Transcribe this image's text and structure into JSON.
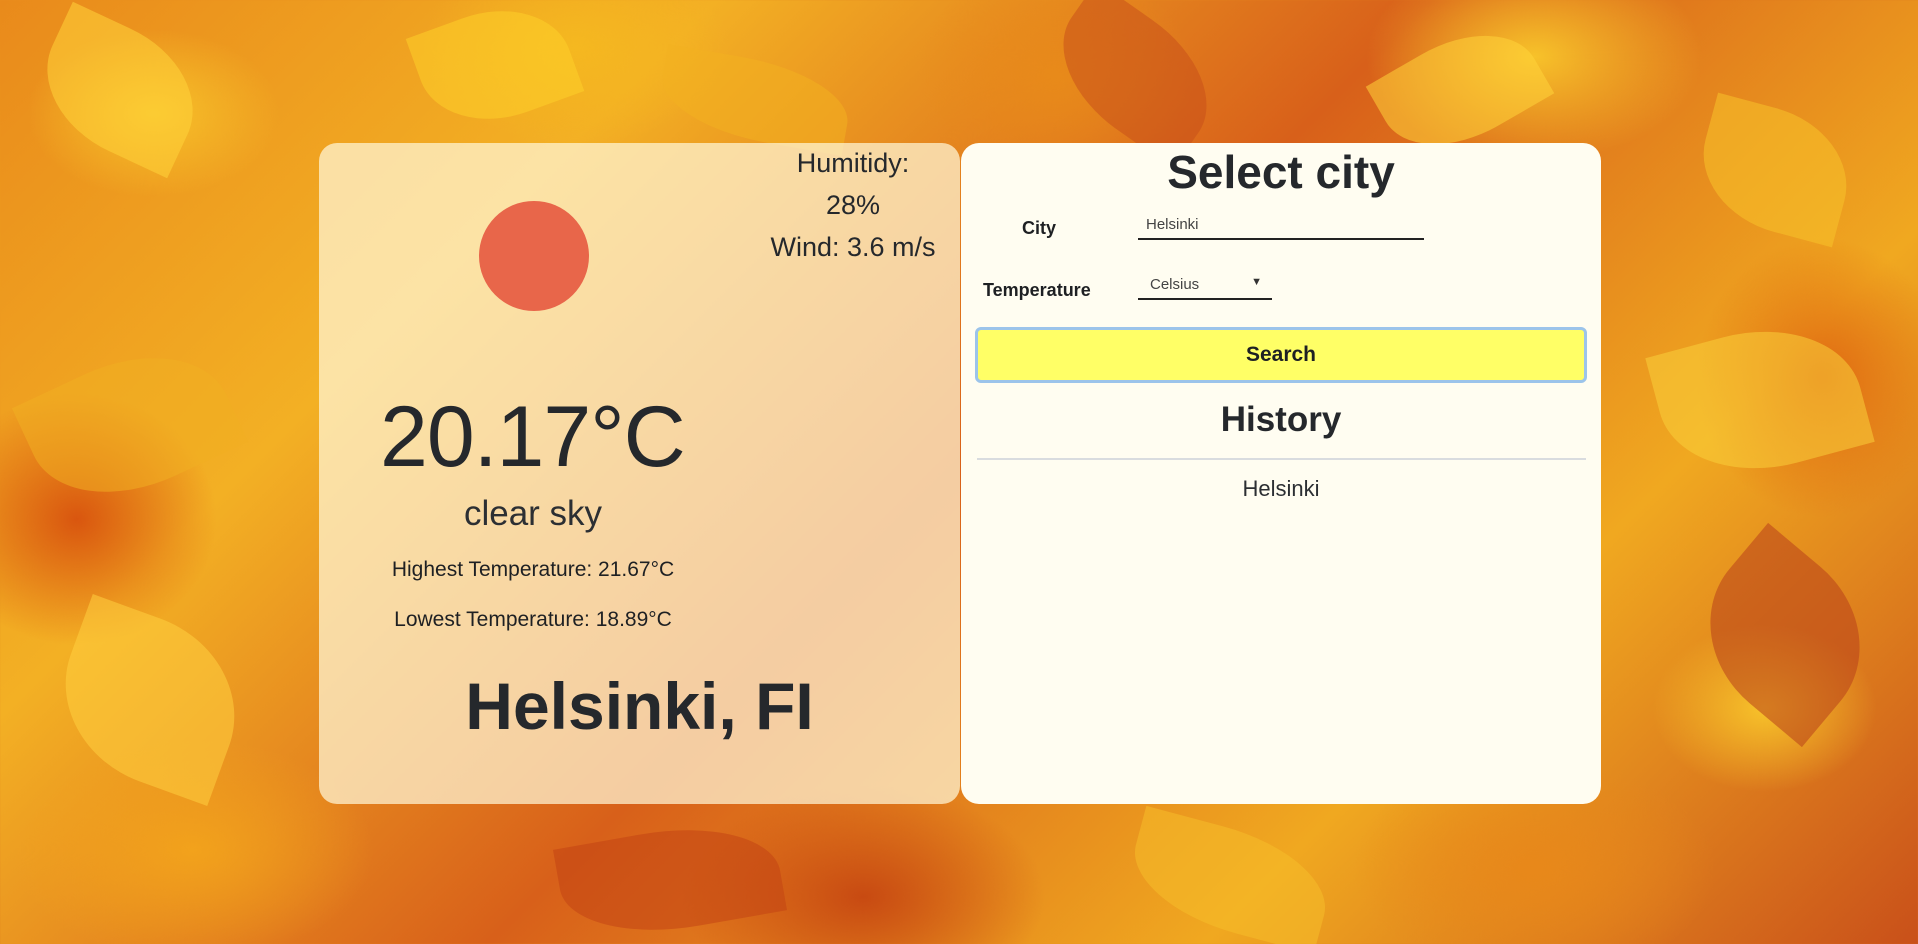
{
  "weather": {
    "humidity_label": "Humitidy:",
    "humidity_value": "28%",
    "wind": "Wind: 3.6 m/s",
    "temperature": "20.17°C",
    "description": "clear sky",
    "highest": "Highest Temperature: 21.67°C",
    "lowest": "Lowest Temperature: 18.89°C",
    "location": "Helsinki, FI",
    "icon": "sun-icon",
    "icon_color": "#e8664a"
  },
  "search": {
    "title": "Select city",
    "city_label": "City",
    "city_value": "Helsinki",
    "temperature_label": "Temperature",
    "unit_selected": "Celsius",
    "button_label": "Search"
  },
  "history": {
    "title": "History",
    "items": [
      "Helsinki"
    ]
  },
  "colors": {
    "button_bg": "#ffff66",
    "button_border": "#9cc4ea",
    "panel_bg": "#fffdf1"
  }
}
